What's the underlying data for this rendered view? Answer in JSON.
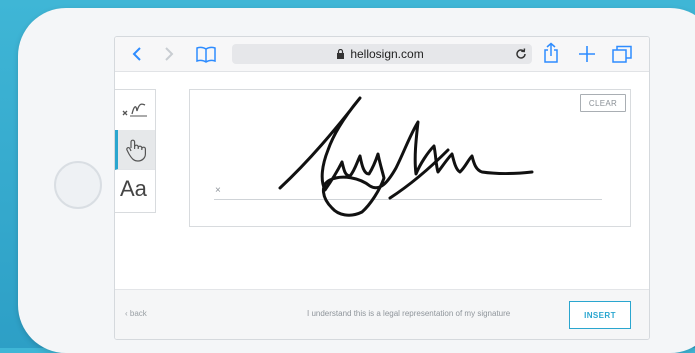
{
  "browser": {
    "url": "hellosign.com",
    "icons": [
      "back-arrow-icon",
      "forward-arrow-icon",
      "bookmarks-icon",
      "lock-icon",
      "reload-icon",
      "share-icon",
      "new-tab-icon",
      "tabs-icon"
    ]
  },
  "tools": [
    {
      "name": "draw-signature",
      "icon": "pen-line-icon"
    },
    {
      "name": "touch-signature",
      "icon": "hand-icon"
    },
    {
      "name": "type-signature",
      "label": "Aa"
    }
  ],
  "signature": {
    "clear_label": "CLEAR",
    "x_mark": "×"
  },
  "footer": {
    "back_label": "‹ back",
    "legal_text": "I understand this is a legal representation of my signature",
    "insert_label": "INSERT"
  },
  "colors": {
    "accent": "#2aa6cf",
    "background": "#3fb6d6"
  }
}
